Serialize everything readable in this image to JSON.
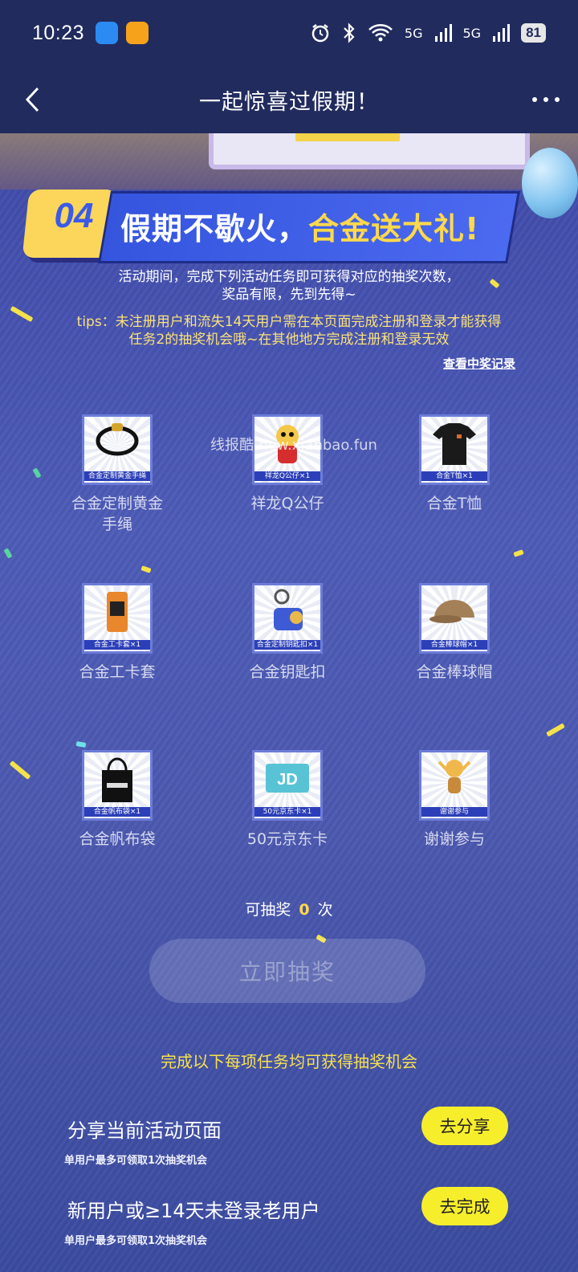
{
  "status_bar": {
    "time": "10:23",
    "signal_a": "5G",
    "signal_b": "5G",
    "battery": "81"
  },
  "nav": {
    "title": "一起惊喜过假期！"
  },
  "header": {
    "number": "04",
    "title_part1": "假期不歇火，",
    "title_part2": "合金送大礼!"
  },
  "description": {
    "line1": "活动期间，完成下列活动任务即可获得对应的抽奖次数，",
    "line2": "奖品有限，先到先得~",
    "tips_line1": "tips：未注册用户和流失14天用户需在本页面完成注册和登录才能获得",
    "tips_line2": "任务2的抽奖机会哦~在其他地方完成注册和登录无效",
    "record_link": "查看中奖记录"
  },
  "watermark": "线报酷-new.xianbao.fun",
  "prizes": [
    {
      "caption": "合金定制黄金手绳",
      "name_line1": "合金定制黄金",
      "name_line2": "手绳"
    },
    {
      "caption": "祥龙Q公仔×1",
      "name_line1": "祥龙Q公仔",
      "name_line2": ""
    },
    {
      "caption": "合金T恤×1",
      "name_line1": "合金T恤",
      "name_line2": ""
    },
    {
      "caption": "合金工卡套×1",
      "name_line1": "合金工卡套",
      "name_line2": ""
    },
    {
      "caption": "合金定制钥匙扣×1",
      "name_line1": "合金钥匙扣",
      "name_line2": ""
    },
    {
      "caption": "合金棒球帽×1",
      "name_line1": "合金棒球帽",
      "name_line2": ""
    },
    {
      "caption": "合金帆布袋×1",
      "name_line1": "合金帆布袋",
      "name_line2": ""
    },
    {
      "caption": "50元京东卡×1",
      "name_line1": "50元京东卡",
      "name_line2": ""
    },
    {
      "caption": "谢谢参与",
      "name_line1": "谢谢参与",
      "name_line2": ""
    }
  ],
  "draw": {
    "label_prefix": "可抽奖",
    "count": "0",
    "label_suffix": "次",
    "button": "立即抽奖"
  },
  "tasks": {
    "header": "完成以下每项任务均可获得抽奖机会",
    "items": [
      {
        "title": "分享当前活动页面",
        "note": "单用户最多可领取1次抽奖机会",
        "button": "去分享"
      },
      {
        "title": "新用户或≥14天未登录老用户",
        "note": "单用户最多可领取1次抽奖机会",
        "button": "去完成"
      }
    ]
  },
  "colors": {
    "nav_bg": "#212b5e",
    "accent_yellow": "#f7ee2b",
    "tips_yellow": "#fbe27a"
  }
}
